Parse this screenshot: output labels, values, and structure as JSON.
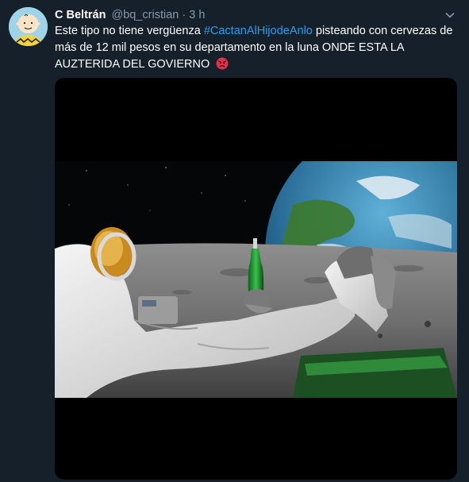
{
  "tweet": {
    "display_name": "C Beltrán",
    "handle": "@bq_cristian",
    "separator": "·",
    "time": "3 h",
    "text_before": "Este tipo no tiene vergüenza ",
    "hashtag": "#CactanAlHijodeAnlo",
    "text_after": " pisteando con cervezas de más de 12 mil pesos en su departamento en la luna ONDE ESTA LA AUZTERIDA DEL GOVIERNO",
    "emoji": "angry-face-emoji",
    "icons": {
      "avatar": "charlie-brown-avatar",
      "menu": "chevron-down-icon"
    }
  },
  "colors": {
    "background": "#15202b",
    "secondary_text": "#8899a6",
    "link": "#1da1f2",
    "media_bg": "#000000"
  }
}
